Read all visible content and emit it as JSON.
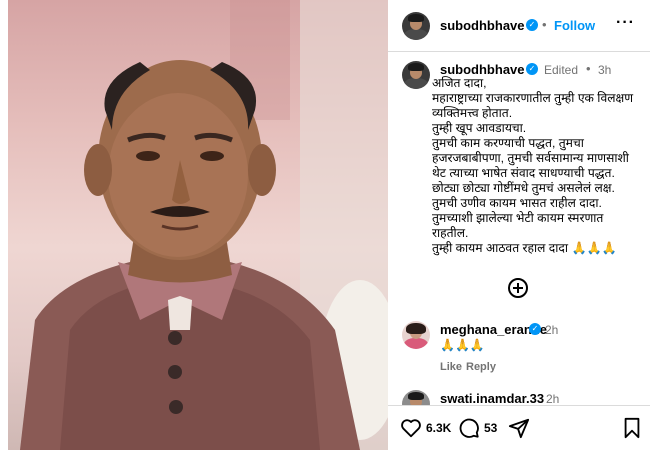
{
  "post": {
    "author": "subodhbhave",
    "follow_label": "Follow",
    "more_label": "···",
    "separator": "•",
    "edited_label": "Edited",
    "age": "3h",
    "caption": "अजित दादा,\nमहाराष्ट्राच्या राजकारणातील तुम्ही एक विलक्षण व्यक्तिमत्त्व होतात.\nतुम्ही खूप आवडायचा.\nतुमची काम करण्याची पद्धत, तुमचा हजरजबाबीपणा, तुमची सर्वसामान्य माणसाशी थेट त्याच्या भाषेत संवाद साधण्याची पद्धत.\nछोट्या छोट्या गोष्टींमधे तुमचं असलेलं लक्ष.\nतुमची उणीव कायम भासत राहील दादा.\nतुमच्याशी झालेल्या भेटी कायम स्मरणात राहतील.\nतुम्ही कायम आठवत रहाल दादा 🙏🙏🙏"
  },
  "comments": [
    {
      "user": "meghana_erande",
      "age": "2h",
      "text": "🙏🙏🙏",
      "like_label": "Like",
      "reply_label": "Reply"
    },
    {
      "user": "swati.inamdar.33",
      "age": "2h"
    }
  ],
  "actions": {
    "likes": "6.3K",
    "comments": "53"
  },
  "icons": {
    "verified": "verified-badge-icon",
    "add_comment": "plus-circle-icon",
    "like": "heart-icon",
    "comment": "comment-bubble-icon",
    "share": "paper-plane-icon",
    "save": "bookmark-icon"
  },
  "colors": {
    "accent": "#0095f6",
    "muted": "#737373",
    "border": "#dbdbdb"
  }
}
